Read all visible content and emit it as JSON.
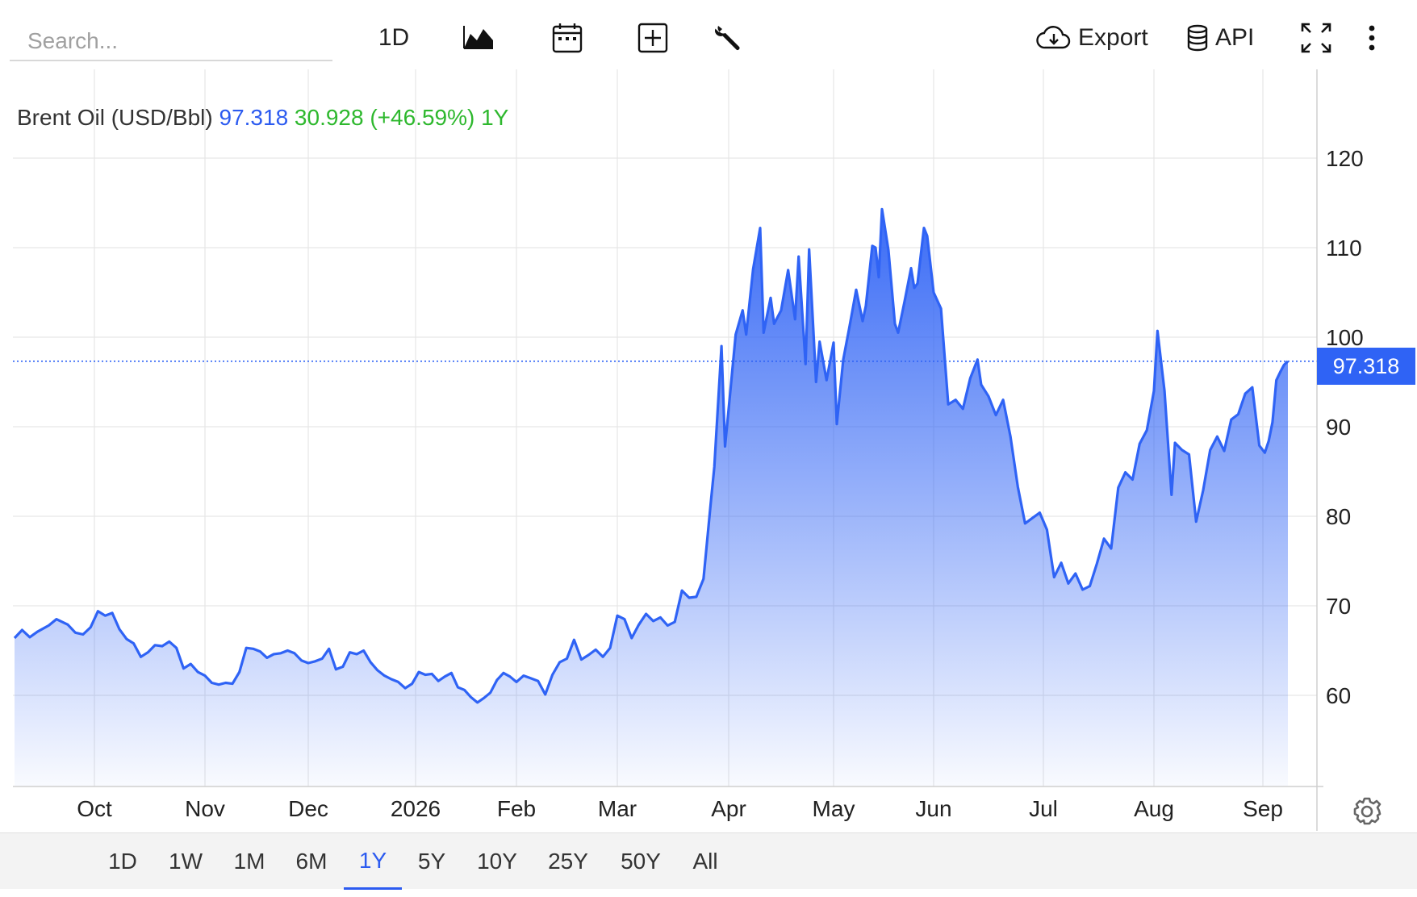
{
  "toolbar": {
    "search_placeholder": "Search...",
    "period_label": "1D",
    "export_label": "Export",
    "api_label": "API"
  },
  "header": {
    "name": "Brent Oil (USD/Bbl)",
    "price": "97.318",
    "change": "30.928 (+46.59%) 1Y"
  },
  "price_tag": "97.318",
  "colors": {
    "line": "#2f63f5",
    "fill_top": "#2f63f5",
    "change_positive": "#2eb82e",
    "grid": "#e6e6e6"
  },
  "range_buttons": {
    "items": [
      "1D",
      "1W",
      "1M",
      "6M",
      "1Y",
      "5Y",
      "10Y",
      "25Y",
      "50Y",
      "All"
    ],
    "active": "1Y"
  },
  "chart_data": {
    "type": "area",
    "title": "Brent Oil (USD/Bbl)",
    "last_value": 97.318,
    "ylim": [
      50,
      128
    ],
    "y_ticks": [
      60,
      70,
      80,
      90,
      100,
      110,
      120
    ],
    "x_ticks": [
      {
        "label": "Oct",
        "date": "2025-10-01"
      },
      {
        "label": "Nov",
        "date": "2025-11-01"
      },
      {
        "label": "Dec",
        "date": "2025-12-01"
      },
      {
        "label": "2026",
        "date": "2026-01-01"
      },
      {
        "label": "Feb",
        "date": "2026-02-01"
      },
      {
        "label": "Mar",
        "date": "2026-03-01"
      },
      {
        "label": "Apr",
        "date": "2026-04-01"
      },
      {
        "label": "May",
        "date": "2026-05-01"
      },
      {
        "label": "Jun",
        "date": "2026-06-01"
      },
      {
        "label": "Jul",
        "date": "2026-07-01"
      },
      {
        "label": "Aug",
        "date": "2026-08-01"
      },
      {
        "label": "Sep",
        "date": "2026-09-01"
      }
    ],
    "grid": true,
    "series": [
      {
        "points": [
          [
            "2025-09-10",
            66.4
          ],
          [
            "2025-09-12",
            67.3
          ],
          [
            "2025-09-14",
            66.5
          ],
          [
            "2025-09-16",
            67.1
          ],
          [
            "2025-09-19",
            67.8
          ],
          [
            "2025-09-21",
            68.5
          ],
          [
            "2025-09-24",
            67.9
          ],
          [
            "2025-09-26",
            67.0
          ],
          [
            "2025-09-28",
            66.8
          ],
          [
            "2025-09-30",
            67.6
          ],
          [
            "2025-10-02",
            69.4
          ],
          [
            "2025-10-04",
            68.9
          ],
          [
            "2025-10-06",
            69.2
          ],
          [
            "2025-10-08",
            67.4
          ],
          [
            "2025-10-10",
            66.3
          ],
          [
            "2025-10-12",
            65.8
          ],
          [
            "2025-10-14",
            64.3
          ],
          [
            "2025-10-16",
            64.8
          ],
          [
            "2025-10-18",
            65.6
          ],
          [
            "2025-10-20",
            65.5
          ],
          [
            "2025-10-22",
            66.0
          ],
          [
            "2025-10-24",
            65.3
          ],
          [
            "2025-10-26",
            63.0
          ],
          [
            "2025-10-28",
            63.5
          ],
          [
            "2025-10-30",
            62.6
          ],
          [
            "2025-11-01",
            62.2
          ],
          [
            "2025-11-03",
            61.4
          ],
          [
            "2025-11-05",
            61.2
          ],
          [
            "2025-11-07",
            61.4
          ],
          [
            "2025-11-09",
            61.3
          ],
          [
            "2025-11-11",
            62.6
          ],
          [
            "2025-11-13",
            65.3
          ],
          [
            "2025-11-15",
            65.2
          ],
          [
            "2025-11-17",
            64.9
          ],
          [
            "2025-11-19",
            64.2
          ],
          [
            "2025-11-21",
            64.6
          ],
          [
            "2025-11-23",
            64.7
          ],
          [
            "2025-11-25",
            65.0
          ],
          [
            "2025-11-27",
            64.7
          ],
          [
            "2025-11-29",
            63.9
          ],
          [
            "2025-12-01",
            63.6
          ],
          [
            "2025-12-03",
            63.8
          ],
          [
            "2025-12-05",
            64.1
          ],
          [
            "2025-12-07",
            65.2
          ],
          [
            "2025-12-09",
            62.9
          ],
          [
            "2025-12-11",
            63.2
          ],
          [
            "2025-12-13",
            64.8
          ],
          [
            "2025-12-15",
            64.6
          ],
          [
            "2025-12-17",
            65.0
          ],
          [
            "2025-12-19",
            63.7
          ],
          [
            "2025-12-21",
            62.8
          ],
          [
            "2025-12-23",
            62.2
          ],
          [
            "2025-12-25",
            61.8
          ],
          [
            "2025-12-27",
            61.5
          ],
          [
            "2025-12-29",
            60.8
          ],
          [
            "2025-12-31",
            61.3
          ],
          [
            "2026-01-02",
            62.6
          ],
          [
            "2026-01-04",
            62.3
          ],
          [
            "2026-01-06",
            62.4
          ],
          [
            "2026-01-08",
            61.6
          ],
          [
            "2026-01-10",
            62.1
          ],
          [
            "2026-01-12",
            62.5
          ],
          [
            "2026-01-14",
            60.9
          ],
          [
            "2026-01-16",
            60.6
          ],
          [
            "2026-01-18",
            59.8
          ],
          [
            "2026-01-20",
            59.2
          ],
          [
            "2026-01-22",
            59.7
          ],
          [
            "2026-01-24",
            60.3
          ],
          [
            "2026-01-26",
            61.7
          ],
          [
            "2026-01-28",
            62.5
          ],
          [
            "2026-01-30",
            62.1
          ],
          [
            "2026-02-01",
            61.5
          ],
          [
            "2026-02-03",
            62.2
          ],
          [
            "2026-02-05",
            61.9
          ],
          [
            "2026-02-07",
            61.6
          ],
          [
            "2026-02-09",
            60.1
          ],
          [
            "2026-02-11",
            62.3
          ],
          [
            "2026-02-13",
            63.7
          ],
          [
            "2026-02-15",
            64.1
          ],
          [
            "2026-02-17",
            66.2
          ],
          [
            "2026-02-19",
            64.0
          ],
          [
            "2026-02-21",
            64.5
          ],
          [
            "2026-02-23",
            65.1
          ],
          [
            "2026-02-25",
            64.3
          ],
          [
            "2026-02-27",
            65.3
          ],
          [
            "2026-03-01",
            68.9
          ],
          [
            "2026-03-03",
            68.5
          ],
          [
            "2026-03-05",
            66.4
          ],
          [
            "2026-03-07",
            67.9
          ],
          [
            "2026-03-09",
            69.1
          ],
          [
            "2026-03-11",
            68.3
          ],
          [
            "2026-03-13",
            68.7
          ],
          [
            "2026-03-15",
            67.8
          ],
          [
            "2026-03-17",
            68.2
          ],
          [
            "2026-03-19",
            71.7
          ],
          [
            "2026-03-21",
            70.9
          ],
          [
            "2026-03-23",
            71.0
          ],
          [
            "2026-03-25",
            73.0
          ],
          [
            "2026-03-27",
            81.4
          ],
          [
            "2026-03-28",
            85.5
          ],
          [
            "2026-03-30",
            99.0
          ],
          [
            "2026-03-31",
            87.8
          ],
          [
            "2026-04-01",
            92.0
          ],
          [
            "2026-04-03",
            100.3
          ],
          [
            "2026-04-05",
            103.0
          ],
          [
            "2026-04-06",
            100.3
          ],
          [
            "2026-04-08",
            107.6
          ],
          [
            "2026-04-10",
            112.2
          ],
          [
            "2026-04-11",
            100.5
          ],
          [
            "2026-04-13",
            104.4
          ],
          [
            "2026-04-14",
            101.5
          ],
          [
            "2026-04-16",
            103.0
          ],
          [
            "2026-04-18",
            107.5
          ],
          [
            "2026-04-20",
            102.0
          ],
          [
            "2026-04-21",
            109.0
          ],
          [
            "2026-04-23",
            97.0
          ],
          [
            "2026-04-24",
            109.8
          ],
          [
            "2026-04-26",
            95.0
          ],
          [
            "2026-04-27",
            99.5
          ],
          [
            "2026-04-29",
            95.2
          ],
          [
            "2026-05-01",
            99.4
          ],
          [
            "2026-05-02",
            90.3
          ],
          [
            "2026-05-04",
            97.5
          ],
          [
            "2026-05-06",
            101.3
          ],
          [
            "2026-05-08",
            105.3
          ],
          [
            "2026-05-10",
            101.8
          ],
          [
            "2026-05-11",
            103.5
          ],
          [
            "2026-05-13",
            110.2
          ],
          [
            "2026-05-14",
            110.0
          ],
          [
            "2026-05-15",
            106.7
          ],
          [
            "2026-05-16",
            114.3
          ],
          [
            "2026-05-18",
            109.7
          ],
          [
            "2026-05-20",
            101.5
          ],
          [
            "2026-05-21",
            100.5
          ],
          [
            "2026-05-23",
            104.0
          ],
          [
            "2026-05-25",
            107.7
          ],
          [
            "2026-05-26",
            105.5
          ],
          [
            "2026-05-27",
            106.0
          ],
          [
            "2026-05-29",
            112.2
          ],
          [
            "2026-05-30",
            111.3
          ],
          [
            "2026-06-01",
            105.0
          ],
          [
            "2026-06-03",
            103.2
          ],
          [
            "2026-06-05",
            92.5
          ],
          [
            "2026-06-07",
            93.0
          ],
          [
            "2026-06-09",
            92.0
          ],
          [
            "2026-06-11",
            95.4
          ],
          [
            "2026-06-13",
            97.5
          ],
          [
            "2026-06-14",
            94.7
          ],
          [
            "2026-06-16",
            93.4
          ],
          [
            "2026-06-18",
            91.3
          ],
          [
            "2026-06-20",
            93.0
          ],
          [
            "2026-06-22",
            88.9
          ],
          [
            "2026-06-24",
            83.3
          ],
          [
            "2026-06-26",
            79.2
          ],
          [
            "2026-06-28",
            79.8
          ],
          [
            "2026-06-30",
            80.4
          ],
          [
            "2026-07-02",
            78.5
          ],
          [
            "2026-07-04",
            73.2
          ],
          [
            "2026-07-06",
            74.8
          ],
          [
            "2026-07-08",
            72.5
          ],
          [
            "2026-07-10",
            73.6
          ],
          [
            "2026-07-12",
            71.8
          ],
          [
            "2026-07-14",
            72.2
          ],
          [
            "2026-07-16",
            74.7
          ],
          [
            "2026-07-18",
            77.5
          ],
          [
            "2026-07-20",
            76.4
          ],
          [
            "2026-07-22",
            83.2
          ],
          [
            "2026-07-24",
            84.9
          ],
          [
            "2026-07-26",
            84.1
          ],
          [
            "2026-07-28",
            88.1
          ],
          [
            "2026-07-30",
            89.6
          ],
          [
            "2026-08-01",
            94.0
          ],
          [
            "2026-08-02",
            100.7
          ],
          [
            "2026-08-04",
            94.0
          ],
          [
            "2026-08-06",
            82.4
          ],
          [
            "2026-08-07",
            88.2
          ],
          [
            "2026-08-09",
            87.4
          ],
          [
            "2026-08-11",
            86.9
          ],
          [
            "2026-08-13",
            79.4
          ],
          [
            "2026-08-15",
            82.9
          ],
          [
            "2026-08-17",
            87.4
          ],
          [
            "2026-08-19",
            88.9
          ],
          [
            "2026-08-21",
            87.3
          ],
          [
            "2026-08-23",
            90.8
          ],
          [
            "2026-08-25",
            91.4
          ],
          [
            "2026-08-27",
            93.7
          ],
          [
            "2026-08-29",
            94.4
          ],
          [
            "2026-08-31",
            87.9
          ],
          [
            "2026-09-02",
            87.1
          ],
          [
            "2026-09-04",
            88.4
          ],
          [
            "2026-09-06",
            90.5
          ],
          [
            "2026-09-08",
            95.2
          ],
          [
            "2026-09-10",
            96.1
          ],
          [
            "2026-09-12",
            96.9
          ],
          [
            "2026-09-14",
            97.318
          ]
        ]
      }
    ]
  }
}
